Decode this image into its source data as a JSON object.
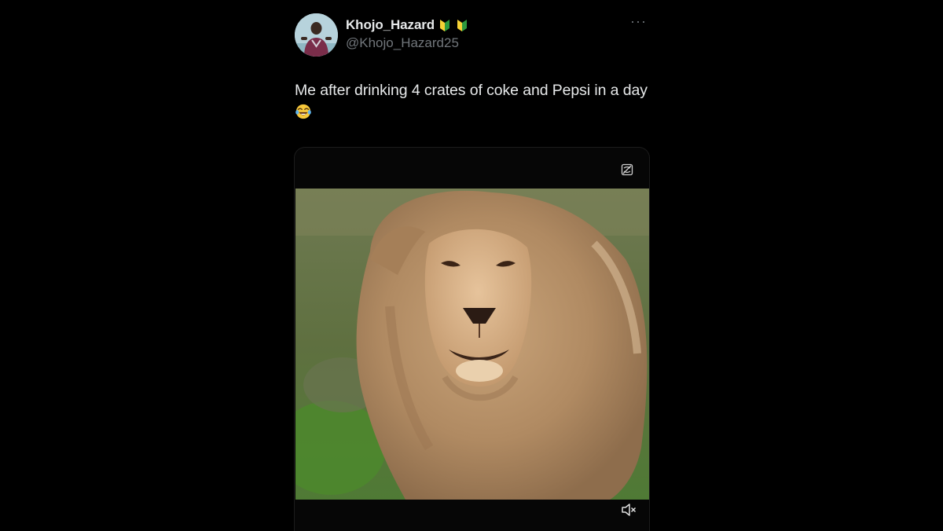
{
  "author": {
    "display_name": "Khojo_Hazard",
    "handle": "@Khojo_Hazard25",
    "badges": [
      "japanese-beginner-symbol-icon",
      "japanese-beginner-symbol-icon"
    ]
  },
  "tweet": {
    "text": "Me after drinking 4 crates of coke and Pepsi in a day",
    "emoji": "face-with-tears-of-joy-icon"
  },
  "media": {
    "type": "video",
    "subject": "lion",
    "controls": [
      "sensitive-content-icon",
      "mute-icon"
    ]
  },
  "colors": {
    "background": "#000000",
    "text_primary": "#e7e9ea",
    "text_secondary": "#71767b",
    "badge_green": "#2e9a3e",
    "badge_yellow": "#f6d235"
  }
}
